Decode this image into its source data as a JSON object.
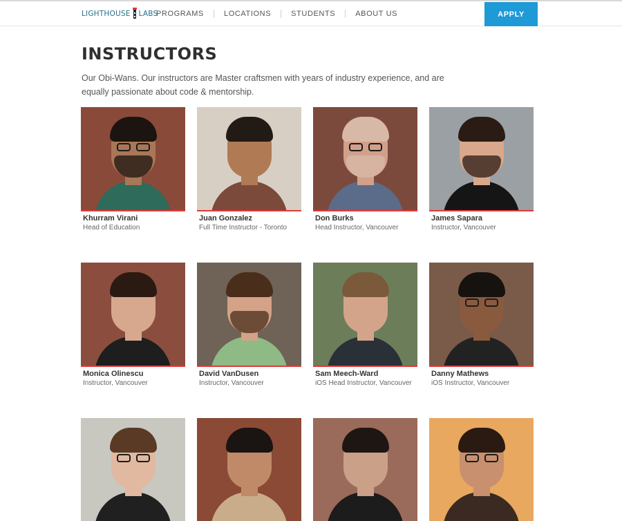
{
  "brand": {
    "logo_left": "LIGHTHOUSE",
    "logo_right": "LABS"
  },
  "nav": {
    "items": [
      "PROGRAMS",
      "LOCATIONS",
      "STUDENTS",
      "ABOUT US"
    ],
    "apply_label": "APPLY",
    "accent": "#1e9ad6"
  },
  "page": {
    "title": "INSTRUCTORS",
    "intro": "Our Obi-Wans. Our instructors are Master craftsmen with years of industry experience, and are equally passionate about code & mentorship."
  },
  "instructors": [
    {
      "name": "Khurram Virani",
      "role": "Head of Education",
      "bg": "#8a4a3a",
      "skin": "#a97757",
      "hair": "#1c1410",
      "shirt": "#2e6b5a",
      "glasses": true,
      "beard": true
    },
    {
      "name": "Juan Gonzalez",
      "role": "Full Time Instructor - Toronto",
      "bg": "#d8cfc4",
      "skin": "#b07a55",
      "hair": "#221a14",
      "shirt": "#7b4a3a",
      "glasses": false,
      "beard": false
    },
    {
      "name": "Don Burks",
      "role": "Head Instructor, Vancouver",
      "bg": "#7c4a3c",
      "skin": "#d2a08a",
      "hair": "#d8b9a8",
      "shirt": "#5a6c8a",
      "glasses": true,
      "beard": true
    },
    {
      "name": "James Sapara",
      "role": "Instructor, Vancouver",
      "bg": "#9aa0a3",
      "skin": "#d9a88c",
      "hair": "#2a1c14",
      "shirt": "#151515",
      "glasses": false,
      "beard": true
    },
    {
      "name": "Monica Olinescu",
      "role": "Instructor, Vancouver",
      "bg": "#8b4e3e",
      "skin": "#d7a88e",
      "hair": "#2a1a12",
      "shirt": "#1e1e1e",
      "glasses": false,
      "beard": false
    },
    {
      "name": "David VanDusen",
      "role": "Instructor, Vancouver",
      "bg": "#6f6256",
      "skin": "#d3a287",
      "hair": "#4a2e1c",
      "shirt": "#8fba86",
      "glasses": false,
      "beard": true
    },
    {
      "name": "Sam Meech-Ward",
      "role": "iOS Head Instructor, Vancouver",
      "bg": "#6c7d5a",
      "skin": "#d3a48a",
      "hair": "#7a5a3a",
      "shirt": "#2a3038",
      "glasses": false,
      "beard": false
    },
    {
      "name": "Danny Mathews",
      "role": "iOS Instructor, Vancouver",
      "bg": "#7a5a48",
      "skin": "#8a5a3e",
      "hair": "#161210",
      "shirt": "#222222",
      "glasses": true,
      "beard": false
    },
    {
      "name": "",
      "role": "",
      "bg": "#c8c8c0",
      "skin": "#e0b9a0",
      "hair": "#5a3a24",
      "shirt": "#202020",
      "glasses": true,
      "beard": false
    },
    {
      "name": "",
      "role": "",
      "bg": "#8a4a36",
      "skin": "#c08a68",
      "hair": "#1a1412",
      "shirt": "#c9ad8a",
      "glasses": false,
      "beard": false
    },
    {
      "name": "",
      "role": "",
      "bg": "#9a6a5a",
      "skin": "#caa088",
      "hair": "#1e1612",
      "shirt": "#1c1c1c",
      "glasses": false,
      "beard": false
    },
    {
      "name": "",
      "role": "",
      "bg": "#e8a860",
      "skin": "#c8906e",
      "hair": "#2a1a12",
      "shirt": "#3a2a22",
      "glasses": true,
      "beard": false
    }
  ]
}
